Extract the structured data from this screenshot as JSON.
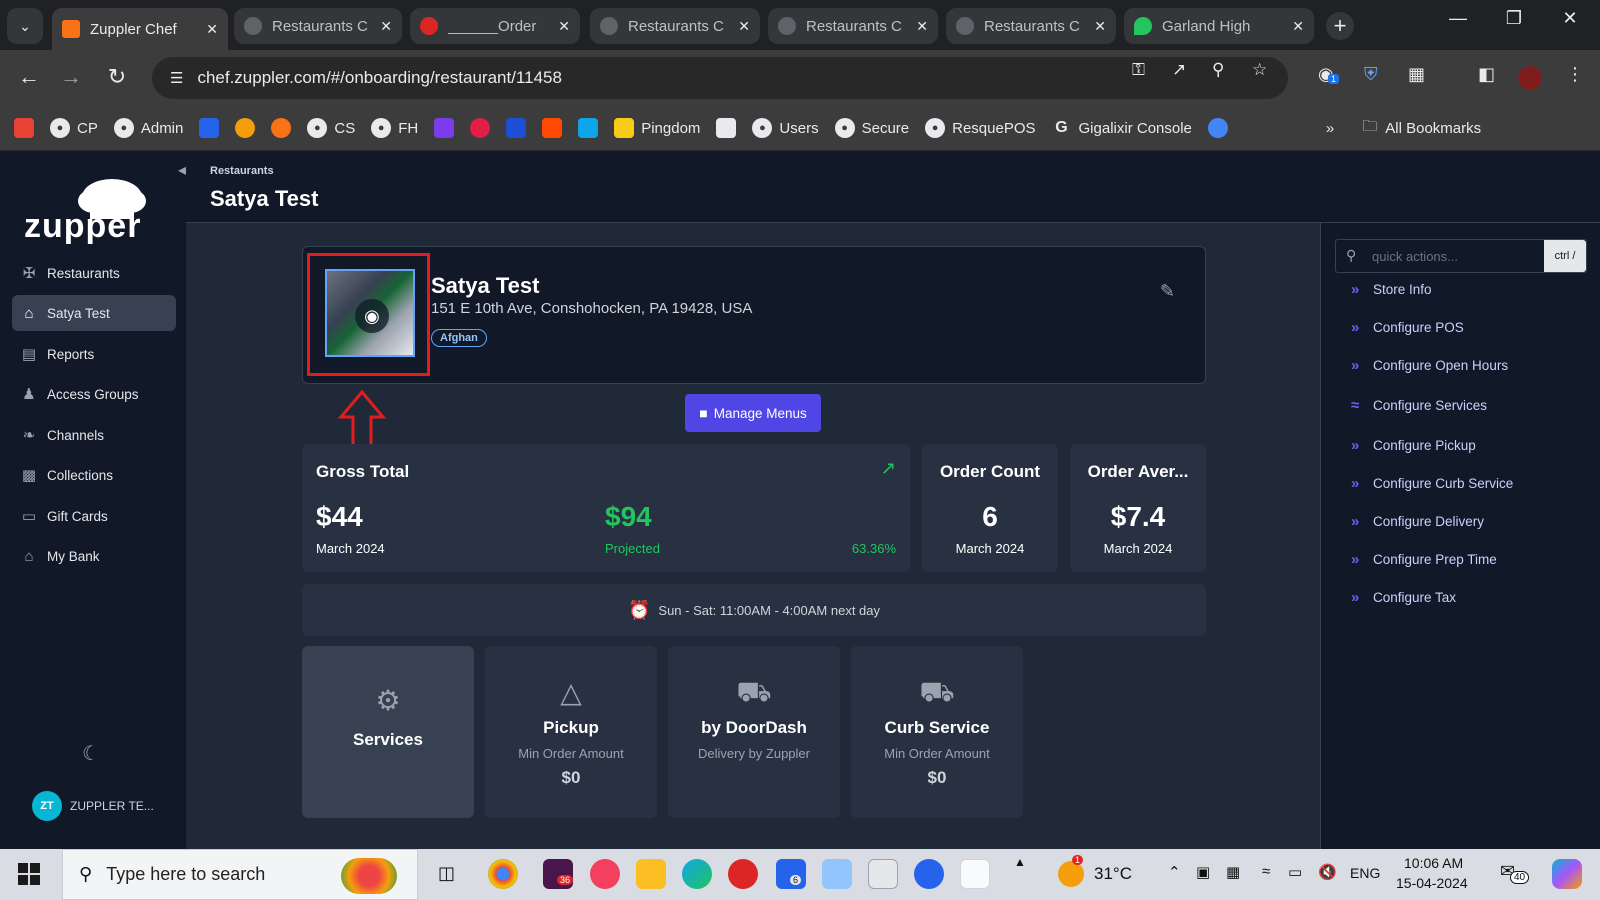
{
  "browser": {
    "tabs": [
      {
        "title": "Zuppler Chef",
        "active": true,
        "color": "#f97316"
      },
      {
        "title": "Restaurants C",
        "active": false,
        "color": "#6b7280"
      },
      {
        "title": "______Order",
        "active": false,
        "color": "#dc2626"
      },
      {
        "title": "Restaurants C",
        "active": false,
        "color": "#6b7280"
      },
      {
        "title": "Restaurants C",
        "active": false,
        "color": "#6b7280"
      },
      {
        "title": "Restaurants C",
        "active": false,
        "color": "#6b7280"
      },
      {
        "title": "Garland High",
        "active": false,
        "color": "#22c55e"
      }
    ],
    "url": "chef.zuppler.com/#/onboarding/restaurant/11458",
    "bookmarks": [
      "CP",
      "Admin",
      "CS",
      "FH",
      "Pingdom",
      "Users",
      "Secure",
      "ResquePOS",
      "Gigalixir Console",
      "All Bookmarks"
    ],
    "extension_badge": "1"
  },
  "app": {
    "logo_text": "zupper",
    "nav": [
      {
        "label": "Restaurants",
        "icon": "utensils-icon"
      },
      {
        "label": "Satya Test",
        "icon": "home-icon"
      },
      {
        "label": "Reports",
        "icon": "chart-icon"
      },
      {
        "label": "Access Groups",
        "icon": "users-icon"
      },
      {
        "label": "Channels",
        "icon": "leaf-icon"
      },
      {
        "label": "Collections",
        "icon": "images-icon"
      },
      {
        "label": "Gift Cards",
        "icon": "card-icon"
      },
      {
        "label": "My Bank",
        "icon": "bank-icon"
      }
    ],
    "user": {
      "initials": "ZT",
      "name": "ZUPPLER TE..."
    },
    "breadcrumb": "Restaurants",
    "page_title": "Satya Test",
    "restaurant": {
      "name": "Satya Test",
      "address": "151 E 10th Ave, Conshohocken, PA 19428, USA",
      "tag": "Afghan"
    },
    "manage_menus": "Manage Menus",
    "gross": {
      "title": "Gross Total",
      "value": "$44",
      "period": "March 2024",
      "projected_value": "$94",
      "projected_label": "Projected",
      "percent": "63.36%"
    },
    "order_count": {
      "title": "Order Count",
      "value": "6",
      "period": "March 2024"
    },
    "order_avg": {
      "title": "Order Aver...",
      "value": "$7.4",
      "period": "March 2024"
    },
    "hours": "Sun - Sat: 11:00AM - 4:00AM next day",
    "services": [
      {
        "title": "Services",
        "sub": "",
        "value": ""
      },
      {
        "title": "Pickup",
        "sub": "Min Order Amount",
        "value": "$0"
      },
      {
        "title": "by DoorDash",
        "sub": "Delivery by Zuppler",
        "value": ""
      },
      {
        "title": "Curb Service",
        "sub": "Min Order Amount",
        "value": "$0"
      }
    ],
    "quick_actions": {
      "placeholder": "quick actions...",
      "shortcut": "ctrl /",
      "items": [
        "Store Info",
        "Configure POS",
        "Configure Open Hours",
        "Configure Services",
        "Configure Pickup",
        "Configure Curb Service",
        "Configure Delivery",
        "Configure Prep Time",
        "Configure Tax"
      ]
    }
  },
  "taskbar": {
    "search_placeholder": "Type here to search",
    "temperature": "31°C",
    "language": "ENG",
    "time": "10:06 AM",
    "date": "15-04-2024",
    "notifications": "40",
    "slack_badge": "36",
    "vscode_badge": "6",
    "weather_badge": "1"
  },
  "colors": {
    "accent": "#4f46e5",
    "positive": "#22c55e",
    "annotation": "#e11d1d"
  }
}
